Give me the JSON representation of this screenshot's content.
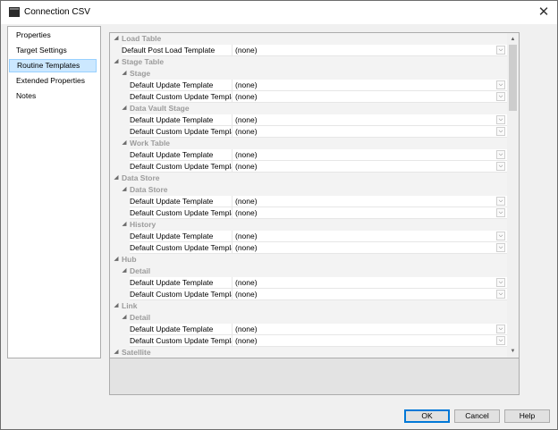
{
  "window": {
    "title": "Connection CSV"
  },
  "nav": {
    "items": [
      {
        "label": "Properties",
        "selected": false
      },
      {
        "label": "Target Settings",
        "selected": false
      },
      {
        "label": "Routine Templates",
        "selected": true
      },
      {
        "label": "Extended Properties",
        "selected": false
      },
      {
        "label": "Notes",
        "selected": false
      }
    ]
  },
  "grid": {
    "rows": [
      {
        "kind": "cat",
        "level": 0,
        "label": "Load Table"
      },
      {
        "kind": "prop",
        "level": 0,
        "name": "Default Post Load Template",
        "value": "(none)"
      },
      {
        "kind": "cat",
        "level": 0,
        "label": "Stage Table"
      },
      {
        "kind": "cat",
        "level": 1,
        "label": "Stage"
      },
      {
        "kind": "prop",
        "level": 1,
        "name": "Default Update Template",
        "value": "(none)"
      },
      {
        "kind": "prop",
        "level": 1,
        "name": "Default Custom Update Templat",
        "value": "(none)"
      },
      {
        "kind": "cat",
        "level": 1,
        "label": "Data Vault Stage"
      },
      {
        "kind": "prop",
        "level": 1,
        "name": "Default Update Template",
        "value": "(none)"
      },
      {
        "kind": "prop",
        "level": 1,
        "name": "Default Custom Update Templat",
        "value": "(none)"
      },
      {
        "kind": "cat",
        "level": 1,
        "label": "Work Table"
      },
      {
        "kind": "prop",
        "level": 1,
        "name": "Default Update Template",
        "value": "(none)"
      },
      {
        "kind": "prop",
        "level": 1,
        "name": "Default Custom Update Templat",
        "value": "(none)"
      },
      {
        "kind": "cat",
        "level": 0,
        "label": "Data Store"
      },
      {
        "kind": "cat",
        "level": 1,
        "label": "Data Store"
      },
      {
        "kind": "prop",
        "level": 1,
        "name": "Default Update Template",
        "value": "(none)"
      },
      {
        "kind": "prop",
        "level": 1,
        "name": "Default Custom Update Templat",
        "value": "(none)"
      },
      {
        "kind": "cat",
        "level": 1,
        "label": "History"
      },
      {
        "kind": "prop",
        "level": 1,
        "name": "Default Update Template",
        "value": "(none)"
      },
      {
        "kind": "prop",
        "level": 1,
        "name": "Default Custom Update Templat",
        "value": "(none)"
      },
      {
        "kind": "cat",
        "level": 0,
        "label": "Hub"
      },
      {
        "kind": "cat",
        "level": 1,
        "label": "Detail"
      },
      {
        "kind": "prop",
        "level": 1,
        "name": "Default Update Template",
        "value": "(none)"
      },
      {
        "kind": "prop",
        "level": 1,
        "name": "Default Custom Update Templat",
        "value": "(none)"
      },
      {
        "kind": "cat",
        "level": 0,
        "label": "Link"
      },
      {
        "kind": "cat",
        "level": 1,
        "label": "Detail"
      },
      {
        "kind": "prop",
        "level": 1,
        "name": "Default Update Template",
        "value": "(none)"
      },
      {
        "kind": "prop",
        "level": 1,
        "name": "Default Custom Update Templat",
        "value": "(none)"
      },
      {
        "kind": "cat",
        "level": 0,
        "label": "Satellite"
      }
    ]
  },
  "buttons": {
    "ok": "OK",
    "cancel": "Cancel",
    "help": "Help"
  },
  "icons": {
    "collapse": "◢",
    "dropdown": "⌵",
    "close": "✕",
    "scroll_up": "▲",
    "scroll_down": "▼"
  }
}
